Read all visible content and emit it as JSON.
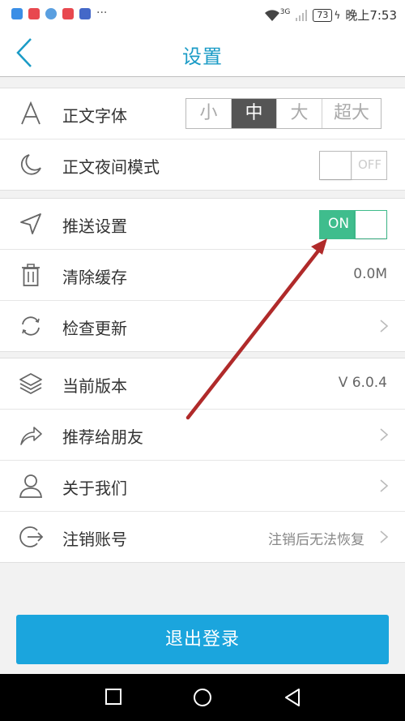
{
  "status_bar": {
    "app_icon_colors": [
      "#3a8ee6",
      "#e8484f",
      "#5a9fe0",
      "#e8484f",
      "#4468c8"
    ],
    "overflow": "···",
    "network_type": "3G",
    "battery": "73",
    "time": "晚上7:53"
  },
  "header": {
    "title": "设置"
  },
  "font_row": {
    "label": "正文字体",
    "options": [
      "小",
      "中",
      "大",
      "超大"
    ],
    "selected_option": "中"
  },
  "night_row": {
    "label": "正文夜间模式",
    "toggle_text": "OFF"
  },
  "push_row": {
    "label": "推送设置",
    "toggle_text": "ON"
  },
  "cache_row": {
    "label": "清除缓存",
    "value": "0.0M"
  },
  "update_row": {
    "label": "检查更新"
  },
  "version_row": {
    "label": "当前版本",
    "value": "V 6.0.4"
  },
  "recommend_row": {
    "label": "推荐给朋友"
  },
  "about_row": {
    "label": "关于我们"
  },
  "cancel_row": {
    "label": "注销账号",
    "hint": "注销后无法恢复"
  },
  "logout_button": {
    "label": "退出登录"
  },
  "colors": {
    "accent": "#1a9bc6",
    "toggle_on": "#3fbd8d",
    "logout": "#1ba5dd",
    "annotation_arrow": "#b02a2a"
  }
}
